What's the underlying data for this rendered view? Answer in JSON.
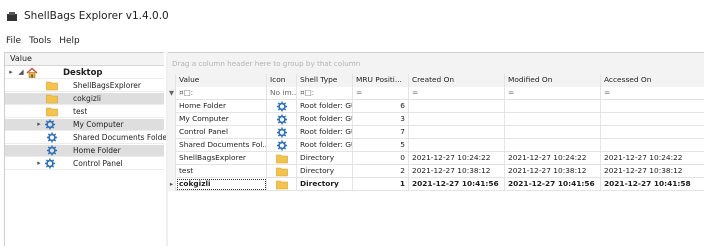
{
  "app": {
    "title": "ShellBags Explorer v1.4.0.0"
  },
  "menu": [
    "File",
    "Tools",
    "Help"
  ],
  "tree": {
    "header": "Value",
    "expand_collapsed": "▸",
    "expand_open": "◢",
    "items": [
      {
        "label": "Desktop",
        "icon": "home-icon"
      },
      {
        "label": "ShellBagsExplorer",
        "icon": "folder-icon"
      },
      {
        "label": "cokgizli",
        "icon": "folder-icon"
      },
      {
        "label": "test",
        "icon": "folder-icon"
      },
      {
        "label": "My Computer",
        "icon": "gear-icon"
      },
      {
        "label": "Shared Documents Folde",
        "icon": "gear-icon"
      },
      {
        "label": "Home Folder",
        "icon": "gear-icon"
      },
      {
        "label": "Control Panel",
        "icon": "gear-icon"
      }
    ]
  },
  "grid": {
    "group_hint": "Drag a column header here to group by that column",
    "row_indicator": "▸",
    "columns": [
      "Value",
      "Icon",
      "Shell Type",
      "MRU Positi...",
      "Created On",
      "Modified On",
      "Accessed On"
    ],
    "filter": {
      "indicator": "▼",
      "value": "¤□:",
      "icon": "No im...",
      "shell_type": "¤□:",
      "mru": "=",
      "created": "=",
      "modified": "=",
      "accessed": "="
    },
    "rows": [
      {
        "value": "Home Folder",
        "icon": "gear-icon",
        "shell_type": "Root folder: GU...",
        "mru": "6",
        "created": "",
        "modified": "",
        "accessed": ""
      },
      {
        "value": "My Computer",
        "icon": "gear-icon",
        "shell_type": "Root folder: GU...",
        "mru": "3",
        "created": "",
        "modified": "",
        "accessed": ""
      },
      {
        "value": "Control Panel",
        "icon": "gear-icon",
        "shell_type": "Root folder: GU...",
        "mru": "7",
        "created": "",
        "modified": "",
        "accessed": ""
      },
      {
        "value": "Shared Documents Fol...",
        "icon": "gear-icon",
        "shell_type": "Root folder: GU...",
        "mru": "5",
        "created": "",
        "modified": "",
        "accessed": ""
      },
      {
        "value": "ShellBagsExplorer",
        "icon": "folder-icon",
        "shell_type": "Directory",
        "mru": "0",
        "created": "2021-12-27 10:24:22",
        "modified": "2021-12-27 10:24:22",
        "accessed": "2021-12-27 10:24:22"
      },
      {
        "value": "test",
        "icon": "folder-icon",
        "shell_type": "Directory",
        "mru": "2",
        "created": "2021-12-27 10:38:12",
        "modified": "2021-12-27 10:38:12",
        "accessed": "2021-12-27 10:38:12"
      },
      {
        "value": "cokgizli",
        "icon": "folder-icon",
        "shell_type": "Directory",
        "mru": "1",
        "created": "2021-12-27 10:41:56",
        "modified": "2021-12-27 10:41:56",
        "accessed": "2021-12-27 10:41:58"
      }
    ]
  },
  "colors": {
    "folder": "#f3c34d",
    "gear": "#2f6fb3",
    "grid_line": "#e4e4e4",
    "header_bg": "#f3f3f3"
  }
}
